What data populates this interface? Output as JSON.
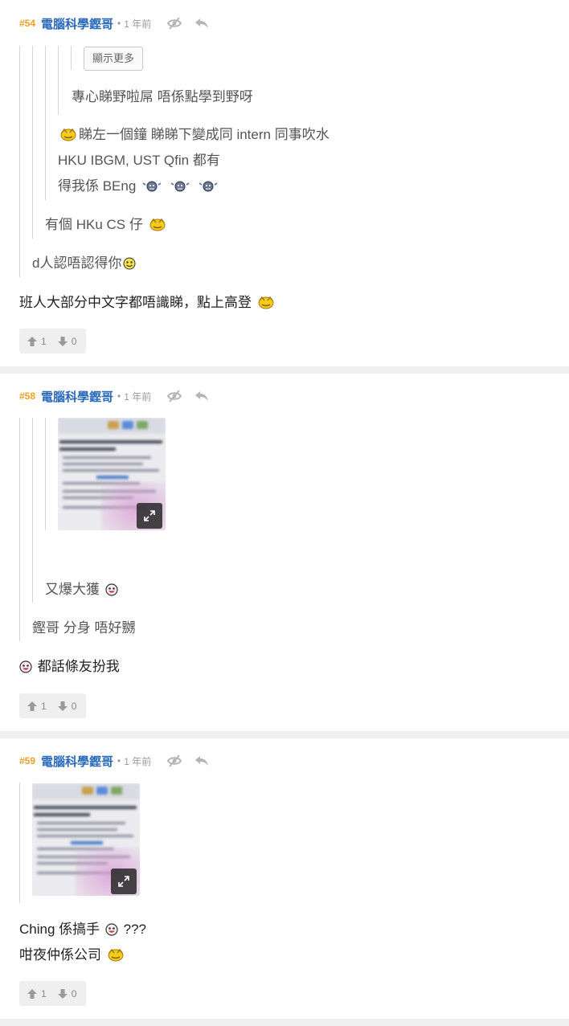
{
  "posts": [
    {
      "num": "#54",
      "author": "電腦科學鏗哥",
      "dot": "•",
      "time": "1 年前",
      "show_more": "顯示更多",
      "quotes": {
        "q4": "專心睇野啦屌 唔係點學到野呀",
        "q3_line1": "睇左一個鐘 睇睇下變成同 intern 同事吹水",
        "q3_line2": "HKU IBGM, UST Qfin 都有",
        "q3_line3": "得我係 BEng",
        "q2": "有個 HKu CS 仔",
        "q1": "d人認唔認得你"
      },
      "body": "班人大部分中文字都唔識睇，點上高登",
      "up": "1",
      "down": "0"
    },
    {
      "num": "#58",
      "author": "電腦科學鏗哥",
      "dot": "•",
      "time": "1 年前",
      "quotes": {
        "q2": "又爆大獲",
        "q1": "鏗哥 分身 唔好嬲"
      },
      "body": "都話條友扮我",
      "up": "1",
      "down": "0",
      "image_text": "Welcome to MTR| Your Familiarization Journey - Induction W"
    },
    {
      "num": "#59",
      "author": "電腦科學鏗哥",
      "dot": "•",
      "time": "1 年前",
      "body_line1": "Ching 係搞手",
      "body_line1_suffix": "???",
      "body_line2": "咁夜仲係公司",
      "up": "1",
      "down": "0",
      "image_text": "Welcome to MTR| Your Familiarization Journey - Induction W"
    }
  ],
  "icons": {
    "hide": "eye-slash-icon",
    "reply": "reply-icon",
    "upvote": "thumb-up-icon",
    "downvote": "thumb-down-icon",
    "expand": "expand-icon"
  },
  "colors": {
    "post_number": "#f0a020",
    "author": "#2a6ab8",
    "meta": "#9a9a9a",
    "background": "#f0f0f0"
  }
}
